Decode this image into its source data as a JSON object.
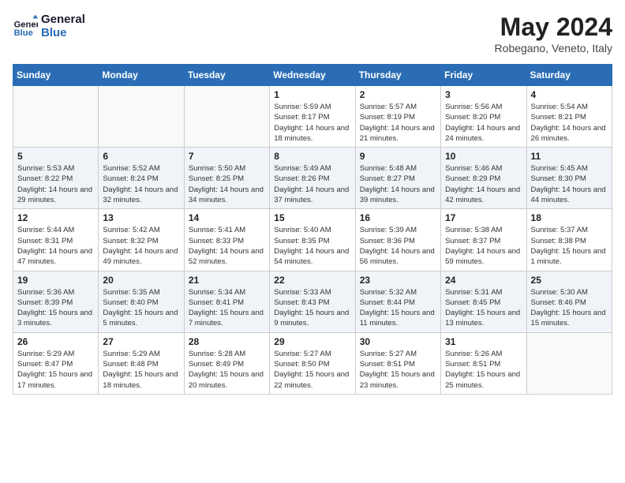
{
  "header": {
    "logo_line1": "General",
    "logo_line2": "Blue",
    "month_title": "May 2024",
    "location": "Robegano, Veneto, Italy"
  },
  "weekdays": [
    "Sunday",
    "Monday",
    "Tuesday",
    "Wednesday",
    "Thursday",
    "Friday",
    "Saturday"
  ],
  "weeks": [
    [
      {
        "day": "",
        "info": ""
      },
      {
        "day": "",
        "info": ""
      },
      {
        "day": "",
        "info": ""
      },
      {
        "day": "1",
        "info": "Sunrise: 5:59 AM\nSunset: 8:17 PM\nDaylight: 14 hours\nand 18 minutes."
      },
      {
        "day": "2",
        "info": "Sunrise: 5:57 AM\nSunset: 8:19 PM\nDaylight: 14 hours\nand 21 minutes."
      },
      {
        "day": "3",
        "info": "Sunrise: 5:56 AM\nSunset: 8:20 PM\nDaylight: 14 hours\nand 24 minutes."
      },
      {
        "day": "4",
        "info": "Sunrise: 5:54 AM\nSunset: 8:21 PM\nDaylight: 14 hours\nand 26 minutes."
      }
    ],
    [
      {
        "day": "5",
        "info": "Sunrise: 5:53 AM\nSunset: 8:22 PM\nDaylight: 14 hours\nand 29 minutes."
      },
      {
        "day": "6",
        "info": "Sunrise: 5:52 AM\nSunset: 8:24 PM\nDaylight: 14 hours\nand 32 minutes."
      },
      {
        "day": "7",
        "info": "Sunrise: 5:50 AM\nSunset: 8:25 PM\nDaylight: 14 hours\nand 34 minutes."
      },
      {
        "day": "8",
        "info": "Sunrise: 5:49 AM\nSunset: 8:26 PM\nDaylight: 14 hours\nand 37 minutes."
      },
      {
        "day": "9",
        "info": "Sunrise: 5:48 AM\nSunset: 8:27 PM\nDaylight: 14 hours\nand 39 minutes."
      },
      {
        "day": "10",
        "info": "Sunrise: 5:46 AM\nSunset: 8:29 PM\nDaylight: 14 hours\nand 42 minutes."
      },
      {
        "day": "11",
        "info": "Sunrise: 5:45 AM\nSunset: 8:30 PM\nDaylight: 14 hours\nand 44 minutes."
      }
    ],
    [
      {
        "day": "12",
        "info": "Sunrise: 5:44 AM\nSunset: 8:31 PM\nDaylight: 14 hours\nand 47 minutes."
      },
      {
        "day": "13",
        "info": "Sunrise: 5:42 AM\nSunset: 8:32 PM\nDaylight: 14 hours\nand 49 minutes."
      },
      {
        "day": "14",
        "info": "Sunrise: 5:41 AM\nSunset: 8:33 PM\nDaylight: 14 hours\nand 52 minutes."
      },
      {
        "day": "15",
        "info": "Sunrise: 5:40 AM\nSunset: 8:35 PM\nDaylight: 14 hours\nand 54 minutes."
      },
      {
        "day": "16",
        "info": "Sunrise: 5:39 AM\nSunset: 8:36 PM\nDaylight: 14 hours\nand 56 minutes."
      },
      {
        "day": "17",
        "info": "Sunrise: 5:38 AM\nSunset: 8:37 PM\nDaylight: 14 hours\nand 59 minutes."
      },
      {
        "day": "18",
        "info": "Sunrise: 5:37 AM\nSunset: 8:38 PM\nDaylight: 15 hours\nand 1 minute."
      }
    ],
    [
      {
        "day": "19",
        "info": "Sunrise: 5:36 AM\nSunset: 8:39 PM\nDaylight: 15 hours\nand 3 minutes."
      },
      {
        "day": "20",
        "info": "Sunrise: 5:35 AM\nSunset: 8:40 PM\nDaylight: 15 hours\nand 5 minutes."
      },
      {
        "day": "21",
        "info": "Sunrise: 5:34 AM\nSunset: 8:41 PM\nDaylight: 15 hours\nand 7 minutes."
      },
      {
        "day": "22",
        "info": "Sunrise: 5:33 AM\nSunset: 8:43 PM\nDaylight: 15 hours\nand 9 minutes."
      },
      {
        "day": "23",
        "info": "Sunrise: 5:32 AM\nSunset: 8:44 PM\nDaylight: 15 hours\nand 11 minutes."
      },
      {
        "day": "24",
        "info": "Sunrise: 5:31 AM\nSunset: 8:45 PM\nDaylight: 15 hours\nand 13 minutes."
      },
      {
        "day": "25",
        "info": "Sunrise: 5:30 AM\nSunset: 8:46 PM\nDaylight: 15 hours\nand 15 minutes."
      }
    ],
    [
      {
        "day": "26",
        "info": "Sunrise: 5:29 AM\nSunset: 8:47 PM\nDaylight: 15 hours\nand 17 minutes."
      },
      {
        "day": "27",
        "info": "Sunrise: 5:29 AM\nSunset: 8:48 PM\nDaylight: 15 hours\nand 18 minutes."
      },
      {
        "day": "28",
        "info": "Sunrise: 5:28 AM\nSunset: 8:49 PM\nDaylight: 15 hours\nand 20 minutes."
      },
      {
        "day": "29",
        "info": "Sunrise: 5:27 AM\nSunset: 8:50 PM\nDaylight: 15 hours\nand 22 minutes."
      },
      {
        "day": "30",
        "info": "Sunrise: 5:27 AM\nSunset: 8:51 PM\nDaylight: 15 hours\nand 23 minutes."
      },
      {
        "day": "31",
        "info": "Sunrise: 5:26 AM\nSunset: 8:51 PM\nDaylight: 15 hours\nand 25 minutes."
      },
      {
        "day": "",
        "info": ""
      }
    ]
  ]
}
